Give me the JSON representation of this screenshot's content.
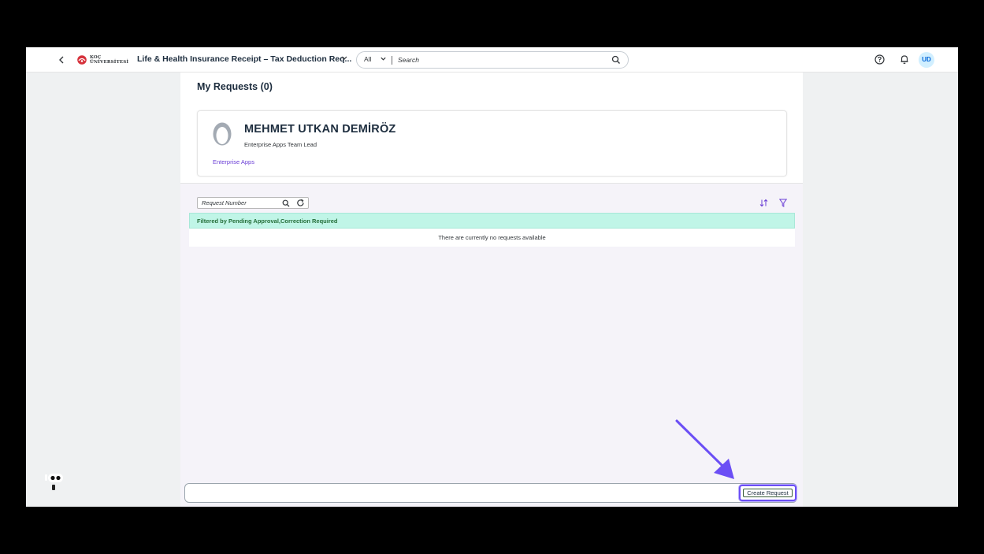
{
  "shellbar": {
    "logo_text_line1": "KOÇ",
    "logo_text_line2": "ÜNİVERSİTESİ",
    "app_title": "Life & Health Insurance Receipt – Tax Deduction Req...",
    "search_scope": "All",
    "search_placeholder": "Search",
    "user_initials": "UD",
    "icons": [
      "back-icon",
      "chevron-down-icon",
      "search-icon",
      "help-icon",
      "bell-icon"
    ]
  },
  "page": {
    "title": "My Requests (0)"
  },
  "profile": {
    "name": "MEHMET UTKAN DEMİRÖZ",
    "role": "Enterprise Apps Team Lead",
    "department": "Enterprise Apps"
  },
  "table": {
    "search_placeholder": "Request Number",
    "filter_info": "Filtered by Pending Approval,Correction Required",
    "empty_text": "There are currently no requests available"
  },
  "footer": {
    "create_label": "Create Request"
  },
  "colors": {
    "accent": "#6b4ef5",
    "link": "#6b3fd6",
    "filter_bar": "#c0f5e7",
    "avatar_bg": "#d1efff"
  }
}
